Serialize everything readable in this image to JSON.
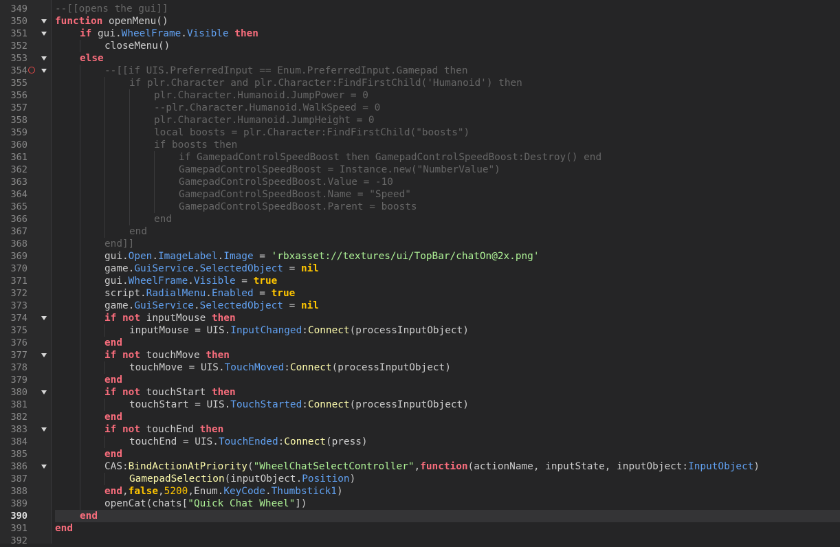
{
  "editor": {
    "current_line": 390,
    "breakpoint_line": 354,
    "fold_lines": [
      350,
      351,
      353,
      354,
      374,
      377,
      380,
      383,
      386
    ],
    "lines": [
      {
        "n": "349",
        "indent": 0,
        "tokens": [
          [
            "cm",
            "--[[opens the gui]]"
          ]
        ]
      },
      {
        "n": "350",
        "indent": 0,
        "tokens": [
          [
            "kw",
            "function"
          ],
          [
            "tx",
            " openMenu()"
          ]
        ]
      },
      {
        "n": "351",
        "indent": 1,
        "tokens": [
          [
            "kw",
            "if"
          ],
          [
            "tx",
            " gui."
          ],
          [
            "pr",
            "WheelFrame"
          ],
          [
            "tx",
            "."
          ],
          [
            "pr",
            "Visible"
          ],
          [
            "tx",
            " "
          ],
          [
            "kw",
            "then"
          ]
        ]
      },
      {
        "n": "352",
        "indent": 2,
        "tokens": [
          [
            "tx",
            "closeMenu()"
          ]
        ]
      },
      {
        "n": "353",
        "indent": 1,
        "tokens": [
          [
            "kw",
            "else"
          ]
        ]
      },
      {
        "n": "354",
        "indent": 2,
        "tokens": [
          [
            "cm",
            "--[[if UIS.PreferredInput == Enum.PreferredInput.Gamepad then"
          ]
        ]
      },
      {
        "n": "355",
        "indent": 3,
        "tokens": [
          [
            "cm",
            "if plr.Character and plr.Character:FindFirstChild('Humanoid') then"
          ]
        ]
      },
      {
        "n": "356",
        "indent": 4,
        "tokens": [
          [
            "cm",
            "plr.Character.Humanoid.JumpPower = 0"
          ]
        ]
      },
      {
        "n": "357",
        "indent": 4,
        "tokens": [
          [
            "cm",
            "--plr.Character.Humanoid.WalkSpeed = 0"
          ]
        ]
      },
      {
        "n": "358",
        "indent": 4,
        "tokens": [
          [
            "cm",
            "plr.Character.Humanoid.JumpHeight = 0"
          ]
        ]
      },
      {
        "n": "359",
        "indent": 4,
        "tokens": [
          [
            "cm",
            "local boosts = plr.Character:FindFirstChild(\"boosts\")"
          ]
        ]
      },
      {
        "n": "360",
        "indent": 4,
        "tokens": [
          [
            "cm",
            "if boosts then"
          ]
        ]
      },
      {
        "n": "361",
        "indent": 5,
        "tokens": [
          [
            "cm",
            "if GamepadControlSpeedBoost then GamepadControlSpeedBoost:Destroy() end"
          ]
        ]
      },
      {
        "n": "362",
        "indent": 5,
        "tokens": [
          [
            "cm",
            "GamepadControlSpeedBoost = Instance.new(\"NumberValue\")"
          ]
        ]
      },
      {
        "n": "363",
        "indent": 5,
        "tokens": [
          [
            "cm",
            "GamepadControlSpeedBoost.Value = -10"
          ]
        ]
      },
      {
        "n": "364",
        "indent": 5,
        "tokens": [
          [
            "cm",
            "GamepadControlSpeedBoost.Name = \"Speed\""
          ]
        ]
      },
      {
        "n": "365",
        "indent": 5,
        "tokens": [
          [
            "cm",
            "GamepadControlSpeedBoost.Parent = boosts"
          ]
        ]
      },
      {
        "n": "366",
        "indent": 4,
        "tokens": [
          [
            "cm",
            "end"
          ]
        ]
      },
      {
        "n": "367",
        "indent": 3,
        "tokens": [
          [
            "cm",
            "end"
          ]
        ]
      },
      {
        "n": "368",
        "indent": 2,
        "tokens": [
          [
            "cm",
            "end]]"
          ]
        ]
      },
      {
        "n": "369",
        "indent": 2,
        "tokens": [
          [
            "tx",
            "gui."
          ],
          [
            "pr",
            "Open"
          ],
          [
            "tx",
            "."
          ],
          [
            "pr",
            "ImageLabel"
          ],
          [
            "tx",
            "."
          ],
          [
            "pr",
            "Image"
          ],
          [
            "tx",
            " = "
          ],
          [
            "st",
            "'rbxasset://textures/ui/TopBar/chatOn@2x.png'"
          ]
        ]
      },
      {
        "n": "370",
        "indent": 2,
        "tokens": [
          [
            "tx",
            "game."
          ],
          [
            "pr",
            "GuiService"
          ],
          [
            "tx",
            "."
          ],
          [
            "pr",
            "SelectedObject"
          ],
          [
            "tx",
            " = "
          ],
          [
            "bi",
            "nil"
          ]
        ]
      },
      {
        "n": "371",
        "indent": 2,
        "tokens": [
          [
            "tx",
            "gui."
          ],
          [
            "pr",
            "WheelFrame"
          ],
          [
            "tx",
            "."
          ],
          [
            "pr",
            "Visible"
          ],
          [
            "tx",
            " = "
          ],
          [
            "bi",
            "true"
          ]
        ]
      },
      {
        "n": "372",
        "indent": 2,
        "tokens": [
          [
            "tx",
            "script."
          ],
          [
            "pr",
            "RadialMenu"
          ],
          [
            "tx",
            "."
          ],
          [
            "pr",
            "Enabled"
          ],
          [
            "tx",
            " = "
          ],
          [
            "bi",
            "true"
          ]
        ]
      },
      {
        "n": "373",
        "indent": 2,
        "tokens": [
          [
            "tx",
            "game."
          ],
          [
            "pr",
            "GuiService"
          ],
          [
            "tx",
            "."
          ],
          [
            "pr",
            "SelectedObject"
          ],
          [
            "tx",
            " = "
          ],
          [
            "bi",
            "nil"
          ]
        ]
      },
      {
        "n": "374",
        "indent": 2,
        "tokens": [
          [
            "kw",
            "if"
          ],
          [
            "tx",
            " "
          ],
          [
            "kw",
            "not"
          ],
          [
            "tx",
            " inputMouse "
          ],
          [
            "kw",
            "then"
          ]
        ]
      },
      {
        "n": "375",
        "indent": 3,
        "tokens": [
          [
            "tx",
            "inputMouse = UIS."
          ],
          [
            "pr",
            "InputChanged"
          ],
          [
            "tx",
            ":"
          ],
          [
            "me",
            "Connect"
          ],
          [
            "tx",
            "(processInputObject)"
          ]
        ]
      },
      {
        "n": "376",
        "indent": 2,
        "tokens": [
          [
            "kw",
            "end"
          ]
        ]
      },
      {
        "n": "377",
        "indent": 2,
        "tokens": [
          [
            "kw",
            "if"
          ],
          [
            "tx",
            " "
          ],
          [
            "kw",
            "not"
          ],
          [
            "tx",
            " touchMove "
          ],
          [
            "kw",
            "then"
          ]
        ]
      },
      {
        "n": "378",
        "indent": 3,
        "tokens": [
          [
            "tx",
            "touchMove = UIS."
          ],
          [
            "pr",
            "TouchMoved"
          ],
          [
            "tx",
            ":"
          ],
          [
            "me",
            "Connect"
          ],
          [
            "tx",
            "(processInputObject)"
          ]
        ]
      },
      {
        "n": "379",
        "indent": 2,
        "tokens": [
          [
            "kw",
            "end"
          ]
        ]
      },
      {
        "n": "380",
        "indent": 2,
        "tokens": [
          [
            "kw",
            "if"
          ],
          [
            "tx",
            " "
          ],
          [
            "kw",
            "not"
          ],
          [
            "tx",
            " touchStart "
          ],
          [
            "kw",
            "then"
          ]
        ]
      },
      {
        "n": "381",
        "indent": 3,
        "tokens": [
          [
            "tx",
            "touchStart = UIS."
          ],
          [
            "pr",
            "TouchStarted"
          ],
          [
            "tx",
            ":"
          ],
          [
            "me",
            "Connect"
          ],
          [
            "tx",
            "(processInputObject)"
          ]
        ]
      },
      {
        "n": "382",
        "indent": 2,
        "tokens": [
          [
            "kw",
            "end"
          ]
        ]
      },
      {
        "n": "383",
        "indent": 2,
        "tokens": [
          [
            "kw",
            "if"
          ],
          [
            "tx",
            " "
          ],
          [
            "kw",
            "not"
          ],
          [
            "tx",
            " touchEnd "
          ],
          [
            "kw",
            "then"
          ]
        ]
      },
      {
        "n": "384",
        "indent": 3,
        "tokens": [
          [
            "tx",
            "touchEnd = UIS."
          ],
          [
            "pr",
            "TouchEnded"
          ],
          [
            "tx",
            ":"
          ],
          [
            "me",
            "Connect"
          ],
          [
            "tx",
            "(press)"
          ]
        ]
      },
      {
        "n": "385",
        "indent": 2,
        "tokens": [
          [
            "kw",
            "end"
          ]
        ]
      },
      {
        "n": "386",
        "indent": 2,
        "tokens": [
          [
            "tx",
            "CAS:"
          ],
          [
            "me",
            "BindActionAtPriority"
          ],
          [
            "tx",
            "("
          ],
          [
            "st",
            "\"WheelChatSelectController\""
          ],
          [
            "tx",
            ","
          ],
          [
            "kw",
            "function"
          ],
          [
            "tx",
            "(actionName, inputState, inputObject:"
          ],
          [
            "pr",
            "InputObject"
          ],
          [
            "tx",
            ")"
          ]
        ]
      },
      {
        "n": "387",
        "indent": 3,
        "tokens": [
          [
            "me",
            "GamepadSelection"
          ],
          [
            "tx",
            "(inputObject."
          ],
          [
            "pr",
            "Position"
          ],
          [
            "tx",
            ")"
          ]
        ]
      },
      {
        "n": "388",
        "indent": 2,
        "tokens": [
          [
            "kw",
            "end"
          ],
          [
            "tx",
            ","
          ],
          [
            "bi",
            "false"
          ],
          [
            "tx",
            ","
          ],
          [
            "nu",
            "5200"
          ],
          [
            "tx",
            ",Enum."
          ],
          [
            "pr",
            "KeyCode"
          ],
          [
            "tx",
            "."
          ],
          [
            "pr",
            "Thumbstick1"
          ],
          [
            "tx",
            ")"
          ]
        ]
      },
      {
        "n": "389",
        "indent": 2,
        "tokens": [
          [
            "tx",
            "openCat(chats["
          ],
          [
            "st",
            "\"Quick Chat Wheel\""
          ],
          [
            "tx",
            "])"
          ]
        ]
      },
      {
        "n": "390",
        "indent": 1,
        "tokens": [
          [
            "kw",
            "end"
          ]
        ]
      },
      {
        "n": "391",
        "indent": 0,
        "tokens": [
          [
            "kw",
            "end"
          ]
        ]
      },
      {
        "n": "392",
        "indent": 0,
        "tokens": []
      }
    ]
  }
}
